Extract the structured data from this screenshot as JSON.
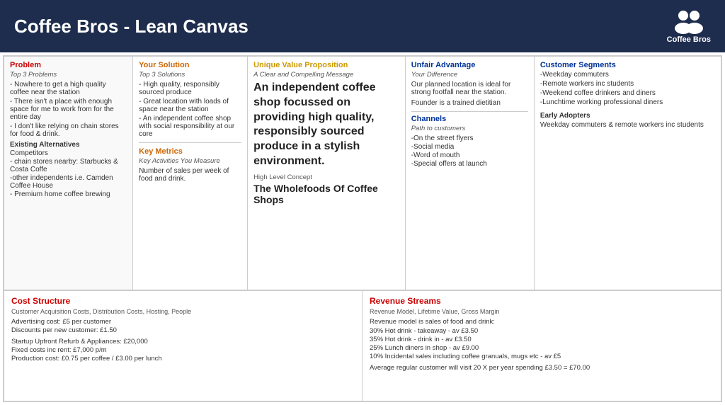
{
  "header": {
    "title": "Coffee Bros - Lean Canvas",
    "logo_label": "Coffee Bros"
  },
  "problem": {
    "heading": "Problem",
    "subheading": "Top 3 Problems",
    "items": [
      "- Nowhere to get a high quality coffee near the station",
      "- There isn't a place with enough space for me to work from for the entire day",
      "- I don't like relying on chain stores for food & drink."
    ],
    "existing_alt": "Existing Alternatives",
    "competitors_label": "Competitors",
    "competitors": [
      "- chain stores nearby: Starbucks & Costa Coffe",
      "-other independents i.e. Camden Coffee House",
      "- Premium home coffee brewing"
    ]
  },
  "solution": {
    "heading": "Your Solution",
    "subheading": "Top 3 Solutions",
    "items": [
      "- High quality, responsibly sourced produce",
      "- Great location with loads of space near the station",
      "- An independent coffee shop with social responsibility at our core"
    ],
    "key_metrics_heading": "Key Metrics",
    "key_metrics_sub": "Key Activities You Measure",
    "key_metrics_text": "Number of sales per week of food and drink."
  },
  "uvp": {
    "heading": "Unique Value Proposition",
    "subheading": "A Clear and Compelling Message",
    "big_text": "An independent coffee shop focussed on providing high quality, responsibly sourced produce in a stylish environment.",
    "high_level_label": "High Level Concept",
    "concept_text": "The Wholefoods Of Coffee Shops"
  },
  "unfair": {
    "heading": "Unfair Advantage",
    "subheading": "Your Difference",
    "text": "Our planned location is ideal for strong footfall near the station.",
    "founder_text": "Founder is a trained dietitian",
    "channels_heading": "Channels",
    "channels_sub": "Path to customers",
    "channels": [
      "-On the street flyers",
      "-Social media",
      "-Word of mouth",
      "-Special offers at launch"
    ]
  },
  "segments": {
    "heading": "Customer Segments",
    "items": [
      "-Weekday commuters",
      "-Remote workers inc students",
      "-Weekend coffee drinkers and diners",
      "-Lunchtime working professional diners"
    ],
    "early_adopters_label": "Early Adopters",
    "early_adopters_text": "Weekday commuters & remote workers inc students"
  },
  "cost_structure": {
    "heading": "Cost Structure",
    "subheading": "Customer Acquisition Costs, Distribution Costs, Hosting, People",
    "lines": [
      "Advertising cost: £5 per customer",
      "Discounts per new customer: £1.50",
      "",
      "Startup Upfront Refurb & Appliances: £20,000",
      "Fixed costs inc rent: £7,000 p/m",
      "Production cost: £0.75 per coffee / £3.00 per lunch"
    ]
  },
  "revenue_streams": {
    "heading": "Revenue Streams",
    "subheading": "Revenue Model, Lifetime Value, Gross Margin",
    "intro": "Revenue model is sales of food and drink:",
    "lines": [
      "30% Hot drink - takeaway - av £3.50",
      "35% Hot drink - drink in - av £3.50",
      "25% Lunch diners in shop - av £9.00",
      "10% Incidental sales including coffee granuals, mugs etc - av £5",
      "",
      "Average regular customer will visit 20 X per year spending £3.50 = £70.00"
    ]
  }
}
